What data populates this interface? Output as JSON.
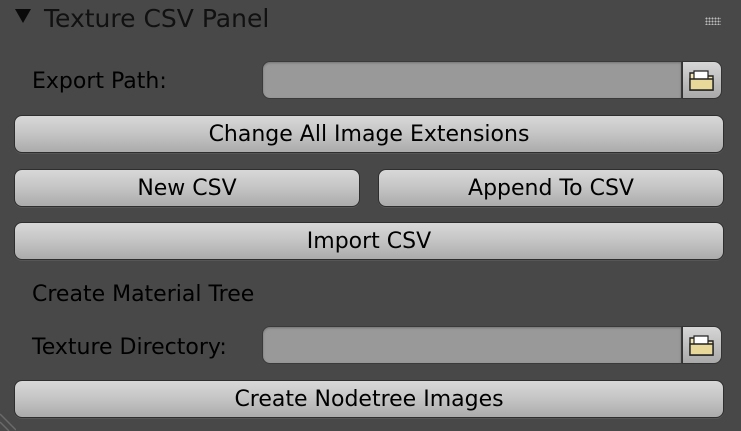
{
  "panel": {
    "title": "Texture CSV Panel"
  },
  "export_path": {
    "label": "Export Path:",
    "value": ""
  },
  "buttons": {
    "change_extensions": "Change All Image Extensions",
    "new_csv": "New CSV",
    "append_csv": "Append To CSV",
    "import_csv": "Import CSV",
    "create_nodetree": "Create Nodetree Images"
  },
  "material_section": {
    "label": "Create Material Tree"
  },
  "texture_directory": {
    "label": "Texture Directory:",
    "value": ""
  },
  "icons": {
    "collapse": "triangle-down-icon",
    "drag": "grip-dots-icon",
    "file_browser": "folder-icon"
  },
  "colors": {
    "background": "#484848",
    "field": "#999999",
    "button_top": "#d8d8d8",
    "button_bottom": "#ababab"
  }
}
